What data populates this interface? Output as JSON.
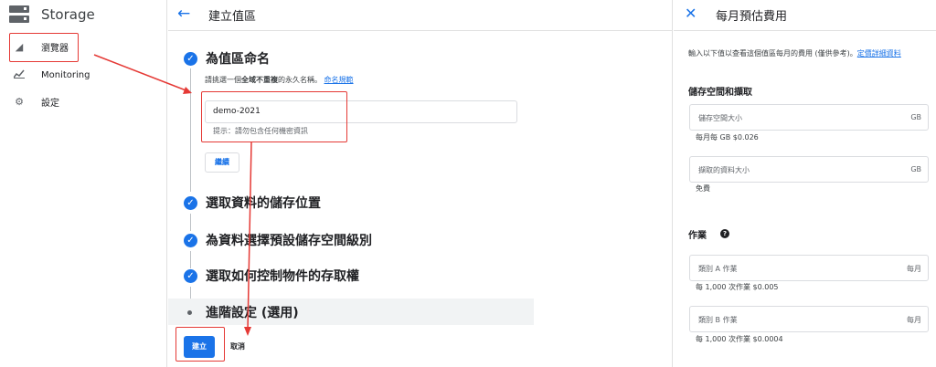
{
  "sidebar": {
    "brand": "Storage",
    "items": [
      {
        "label": "瀏覽器",
        "icon": "basket-icon"
      },
      {
        "label": "Monitoring",
        "icon": "chart-icon"
      },
      {
        "label": "設定",
        "icon": "gear-icon"
      }
    ]
  },
  "create": {
    "title": "建立值區",
    "steps": [
      {
        "title": "為值區命名"
      },
      {
        "title": "選取資料的儲存位置"
      },
      {
        "title": "為資料選擇預設儲存空間級別"
      },
      {
        "title": "選取如何控制物件的存取權"
      },
      {
        "title": "進階設定 (選用)"
      }
    ],
    "name_desc_prefix": "請挑選一個",
    "name_desc_bold": "全域不重複",
    "name_desc_suffix": "的永久名稱。",
    "name_rules_link": "命名規範",
    "name_value": "demo-2021",
    "name_hint": "提示：請勿包含任何機密資訊",
    "continue_label": "繼續",
    "create_label": "建立",
    "cancel_label": "取消"
  },
  "cost": {
    "title": "每月預估費用",
    "desc": "輸入以下值以查看這個值區每月的費用 (僅供參考)。",
    "pricing_link": "定價詳細資料",
    "storage_section": "儲存空間和擷取",
    "storage_size": {
      "placeholder": "儲存空間大小",
      "unit": "GB",
      "rate": "每月每 GB $0.026"
    },
    "retrieval_size": {
      "placeholder": "擷取的資料大小",
      "unit": "GB",
      "rate": "免費"
    },
    "ops_section": "作業",
    "class_a": {
      "placeholder": "類別 A 作業",
      "unit": "每月",
      "rate": "每 1,000 次作業 $0.005"
    },
    "class_b": {
      "placeholder": "類別 B 作業",
      "unit": "每月",
      "rate": "每 1,000 次作業 $0.0004"
    }
  },
  "colors": {
    "accent": "#1a73e8",
    "annotation": "#e53935"
  }
}
